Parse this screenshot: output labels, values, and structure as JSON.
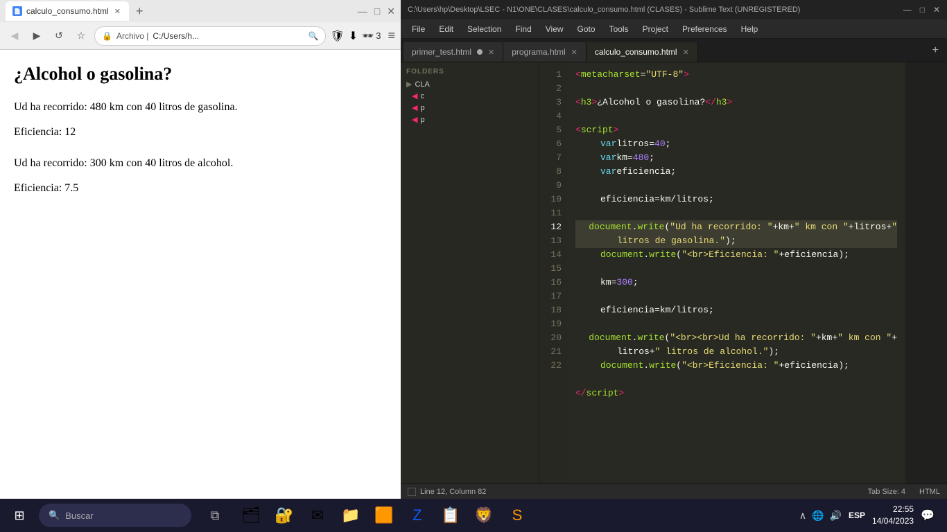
{
  "browser": {
    "tab_title": "calculo_consumo.html",
    "tab_favicon": "📄",
    "address": "C:/Users/h...",
    "toolbar": {
      "back": "◀",
      "forward": "▶",
      "reload": "↺",
      "bookmark": "☆",
      "security": "🔒",
      "address_text": "C:/Users/h...",
      "extensions": "🕶 3",
      "menu": "≡"
    },
    "page": {
      "title": "¿Alcohol o gasolina?",
      "line1": "Ud ha recorrido: 480 km con 40 litros de gasolina.",
      "line2": "Eficiencia: 12",
      "line3": "Ud ha recorrido: 300 km con 40 litros de alcohol.",
      "line4": "Eficiencia: 7.5"
    }
  },
  "sublime": {
    "titlebar": "C:\\Users\\hp\\Desktop\\LSEC - N1\\ONE\\CLASES\\calculo_consumo.html (CLASES) - Sublime Text (UNREGISTERED)",
    "tabs": [
      {
        "label": "primer_test.html",
        "active": false,
        "has_dot": true
      },
      {
        "label": "programa.html",
        "active": false,
        "has_dot": false
      },
      {
        "label": "calculo_consumo.html",
        "active": true,
        "has_dot": false
      }
    ],
    "menu_items": [
      "File",
      "Edit",
      "Selection",
      "Find",
      "View",
      "Goto",
      "Tools",
      "Project",
      "Preferences",
      "Help"
    ],
    "sidebar": {
      "header": "FOLDERS",
      "items": [
        "CLA",
        "c",
        "p",
        "p"
      ]
    },
    "statusbar": {
      "line_col": "Line 12, Column 82",
      "tab_size": "Tab Size: 4",
      "syntax": "HTML"
    }
  },
  "taskbar": {
    "search_placeholder": "Buscar",
    "time": "22:55",
    "date": "14/04/2023",
    "language": "ESP",
    "apps": [
      "🗂",
      "🔒",
      "✉",
      "📁",
      "🟧",
      "🔵",
      "⬛",
      "🟦",
      "🟩"
    ]
  }
}
